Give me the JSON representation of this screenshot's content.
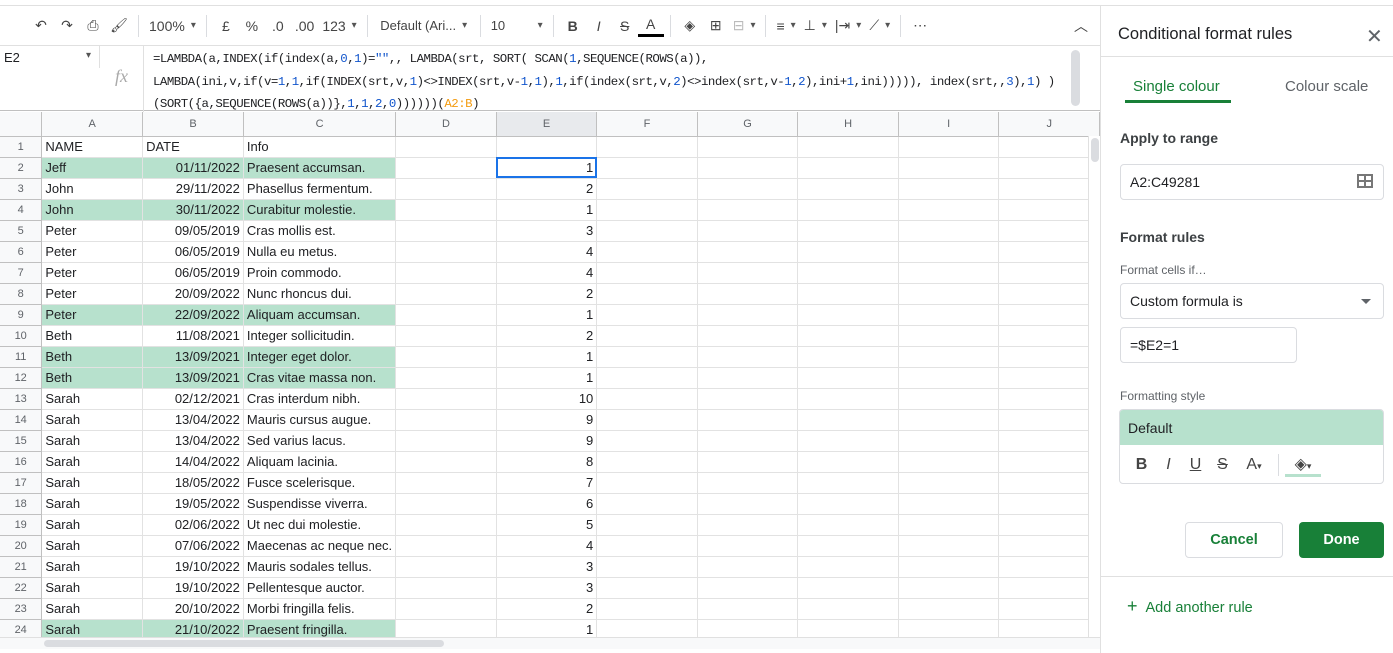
{
  "toolbar": {
    "zoom": "100%",
    "currency": "£",
    "percent": "%",
    "dec_less": ".0",
    "dec_more": ".00",
    "format": "123",
    "font": "Default (Ari...",
    "size": "10",
    "more": "⋯"
  },
  "formula_bar": {
    "cell": "E2",
    "lines": [
      "=LAMBDA(a,INDEX(if(index(a,0,1)=\"\",, LAMBDA(srt, SORT( SCAN(1,SEQUENCE(ROWS(a)),",
      "LAMBDA(ini,v,if(v=1,1,if(INDEX(srt,v,1)<>INDEX(srt,v-1,1),1,if(index(srt,v,2)<>index(srt,v-1,2),ini+1,ini))))), index(srt,,3),1) )",
      "(SORT({a,SEQUENCE(ROWS(a))},1,1,2,0))))))(A2:B)"
    ]
  },
  "columns": [
    "A",
    "B",
    "C",
    "D",
    "E",
    "F",
    "G",
    "H",
    "I",
    "J"
  ],
  "selected_cell": "E2",
  "highlight_color": "#b7e1cd",
  "rows": [
    [
      "NAME",
      "DATE",
      "Info",
      "",
      ""
    ],
    [
      "Jeff",
      "01/11/2022",
      "Praesent accumsan.",
      "",
      "1"
    ],
    [
      "John",
      "29/11/2022",
      "Phasellus fermentum.",
      "",
      "2"
    ],
    [
      "John",
      "30/11/2022",
      "Curabitur molestie.",
      "",
      "1"
    ],
    [
      "Peter",
      "09/05/2019",
      "Cras mollis est.",
      "",
      "3"
    ],
    [
      "Peter",
      "06/05/2019",
      "Nulla eu metus.",
      "",
      "4"
    ],
    [
      "Peter",
      "06/05/2019",
      "Proin commodo.",
      "",
      "4"
    ],
    [
      "Peter",
      "20/09/2022",
      "Nunc rhoncus dui.",
      "",
      "2"
    ],
    [
      "Peter",
      "22/09/2022",
      "Aliquam accumsan.",
      "",
      "1"
    ],
    [
      "Beth",
      "11/08/2021",
      "Integer sollicitudin.",
      "",
      "2"
    ],
    [
      "Beth",
      "13/09/2021",
      "Integer eget dolor.",
      "",
      "1"
    ],
    [
      "Beth",
      "13/09/2021",
      "Cras vitae massa non.",
      "",
      "1"
    ],
    [
      "Sarah",
      "02/12/2021",
      "Cras interdum nibh.",
      "",
      "10"
    ],
    [
      "Sarah",
      "13/04/2022",
      "Mauris cursus augue.",
      "",
      "9"
    ],
    [
      "Sarah",
      "13/04/2022",
      "Sed varius lacus.",
      "",
      "9"
    ],
    [
      "Sarah",
      "14/04/2022",
      "Aliquam lacinia.",
      "",
      "8"
    ],
    [
      "Sarah",
      "18/05/2022",
      "Fusce scelerisque.",
      "",
      "7"
    ],
    [
      "Sarah",
      "19/05/2022",
      "Suspendisse viverra.",
      "",
      "6"
    ],
    [
      "Sarah",
      "02/06/2022",
      "Ut nec dui molestie.",
      "",
      "5"
    ],
    [
      "Sarah",
      "07/06/2022",
      "Maecenas ac neque nec.",
      "",
      "4"
    ],
    [
      "Sarah",
      "19/10/2022",
      "Mauris sodales tellus.",
      "",
      "3"
    ],
    [
      "Sarah",
      "19/10/2022",
      "Pellentesque auctor.",
      "",
      "3"
    ],
    [
      "Sarah",
      "20/10/2022",
      "Morbi fringilla felis.",
      "",
      "2"
    ],
    [
      "Sarah",
      "21/10/2022",
      "Praesent fringilla.",
      "",
      "1"
    ]
  ],
  "panel": {
    "title": "Conditional format rules",
    "tabs": [
      "Single colour",
      "Colour scale"
    ],
    "apply_label": "Apply to range",
    "range": "A2:C49281",
    "rules_label": "Format rules",
    "cells_if_label": "Format cells if…",
    "condition": "Custom formula is",
    "formula": "=$E2=1",
    "style_label": "Formatting style",
    "style_preview": "Default",
    "cancel": "Cancel",
    "done": "Done",
    "add_rule": "Add another rule"
  }
}
